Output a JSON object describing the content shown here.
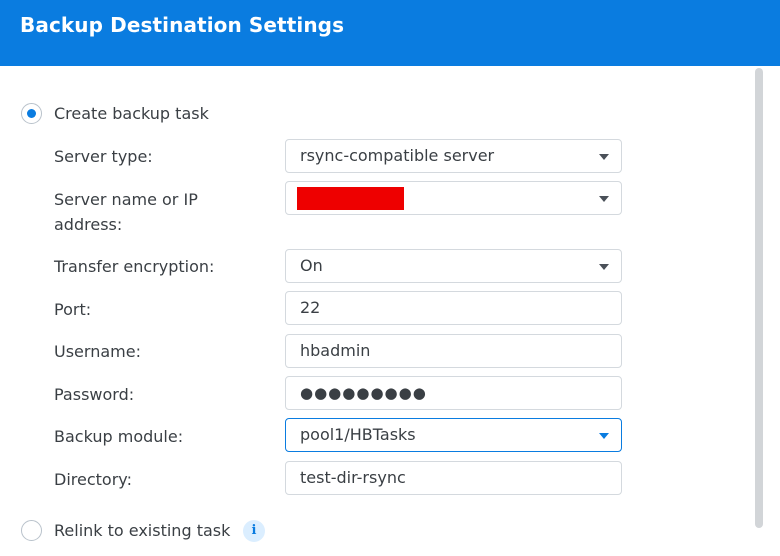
{
  "header": {
    "title": "Backup Destination Settings"
  },
  "options": {
    "create_label": "Create backup task",
    "relink_label": "Relink to existing task",
    "info_symbol": "i"
  },
  "form": {
    "server_type": {
      "label": "Server type:",
      "value": "rsync-compatible server"
    },
    "server_name": {
      "label": "Server name or IP address:",
      "value": ""
    },
    "encryption": {
      "label": "Transfer encryption:",
      "value": "On"
    },
    "port": {
      "label": "Port:",
      "value": "22"
    },
    "username": {
      "label": "Username:",
      "value": "hbadmin"
    },
    "password": {
      "label": "Password:",
      "value": "●●●●●●●●●"
    },
    "module": {
      "label": "Backup module:",
      "value": "pool1/HBTasks"
    },
    "directory": {
      "label": "Directory:",
      "value": "test-dir-rsync"
    }
  },
  "colors": {
    "accent": "#0a7ce0",
    "redaction": "#ee0000"
  },
  "icons": {
    "dropdown": "chevron-down-icon",
    "info": "info-icon"
  }
}
